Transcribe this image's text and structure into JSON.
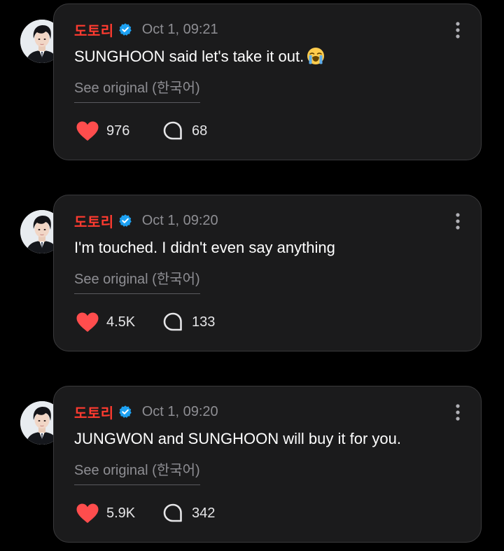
{
  "posts": [
    {
      "username": "도토리",
      "timestamp": "Oct 1, 09:21",
      "text": "SUNGHOON said let's take it out.",
      "emoji": "loudly-crying-face-emoji",
      "see_original": "See original (한국어)",
      "likes": "976",
      "comments": "68"
    },
    {
      "username": "도토리",
      "timestamp": "Oct 1, 09:20",
      "text": "I'm touched. I didn't even say anything",
      "see_original": "See original (한국어)",
      "likes": "4.5K",
      "comments": "133"
    },
    {
      "username": "도토리",
      "timestamp": "Oct 1, 09:20",
      "text": "JUNGWON and SUNGHOON will buy it for you.",
      "see_original": "See original (한국어)",
      "likes": "5.9K",
      "comments": "342"
    }
  ],
  "icons": {
    "verified": "verified-badge-icon",
    "more": "more-vertical-icon",
    "like": "heart-icon",
    "comment": "comment-bubble-icon"
  },
  "colors": {
    "background": "#000000",
    "card": "#1b1b1c",
    "username": "#ff3b30",
    "verified": "#1da1f2",
    "heart": "#ff4d4d",
    "muted_text": "#8e8e93"
  }
}
